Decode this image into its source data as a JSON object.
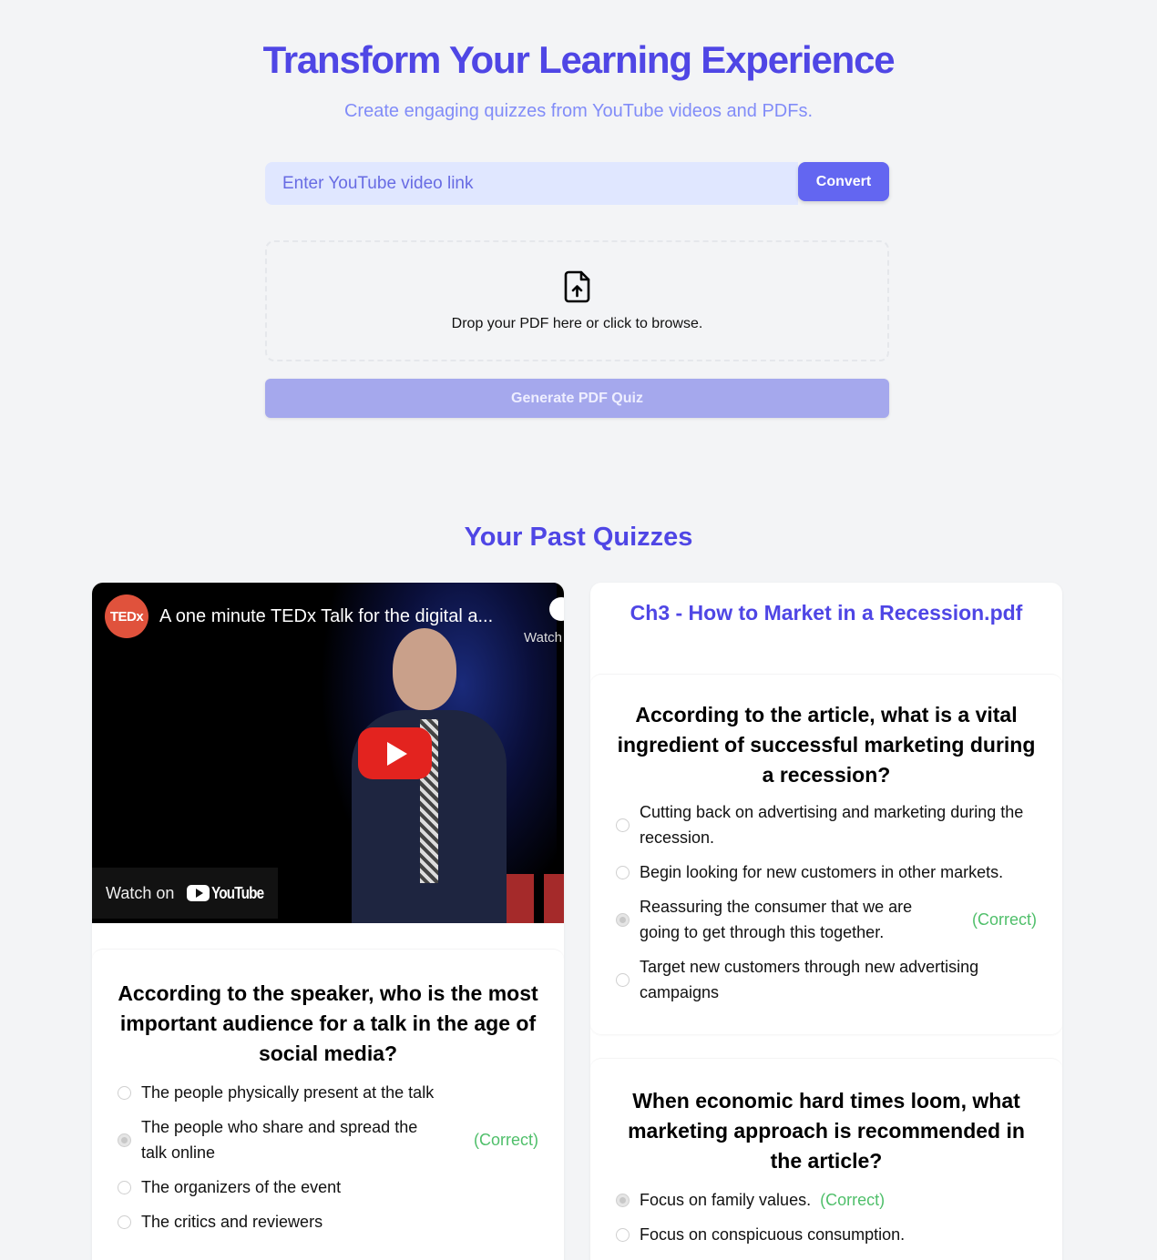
{
  "hero": {
    "title": "Transform Your Learning Experience",
    "subtitle": "Create engaging quizzes from YouTube videos and PDFs."
  },
  "youtube_form": {
    "placeholder": "Enter YouTube video link",
    "value": "",
    "convert_label": "Convert"
  },
  "pdf_upload": {
    "icon": "file-upload-icon",
    "text": "Drop your PDF here or click to browse.",
    "generate_label": "Generate PDF Quiz"
  },
  "past_quizzes": {
    "title": "Your Past Quizzes",
    "quizzes": [
      {
        "type": "youtube",
        "video": {
          "channel_logo": "TEDx",
          "title": "A one minute TEDx Talk for the digital a...",
          "watch_later_label": "Watch",
          "watch_on_label": "Watch on",
          "platform": "YouTube"
        },
        "questions": [
          {
            "question": "According to the speaker, who is the most important audience for a talk in the age of social media?",
            "options": [
              {
                "text": "The people physically present at the talk",
                "selected": false,
                "correct": false
              },
              {
                "text": "The people who share and spread the talk online",
                "selected": true,
                "correct": true
              },
              {
                "text": "The organizers of the event",
                "selected": false,
                "correct": false
              },
              {
                "text": "The critics and reviewers",
                "selected": false,
                "correct": false
              }
            ]
          }
        ]
      },
      {
        "type": "pdf",
        "title": "Ch3 - How to Market in a Recession.pdf",
        "questions": [
          {
            "question": "According to the article, what is a vital ingredient of successful marketing during a recession?",
            "options": [
              {
                "text": "Cutting back on advertising and marketing during the recession.",
                "selected": false,
                "correct": false
              },
              {
                "text": "Begin looking for new customers in other markets.",
                "selected": false,
                "correct": false
              },
              {
                "text": "Reassuring the consumer that we are going to get through this together.",
                "selected": true,
                "correct": true
              },
              {
                "text": "Target new customers through new advertising campaigns",
                "selected": false,
                "correct": false
              }
            ]
          },
          {
            "question": "When economic hard times loom, what marketing approach is recommended in the article?",
            "options": [
              {
                "text": "Focus on family values.",
                "selected": true,
                "correct": true
              },
              {
                "text": "Focus on conspicuous consumption.",
                "selected": false,
                "correct": false
              }
            ]
          }
        ]
      }
    ],
    "correct_label": "(Correct)"
  },
  "colors": {
    "brand": "#4f46e5",
    "button": "#6366f1",
    "button_disabled": "#a5a8ed",
    "input_bg": "#e0e7ff",
    "correct": "#4fbf6a",
    "page_bg": "#f3f4f6"
  }
}
